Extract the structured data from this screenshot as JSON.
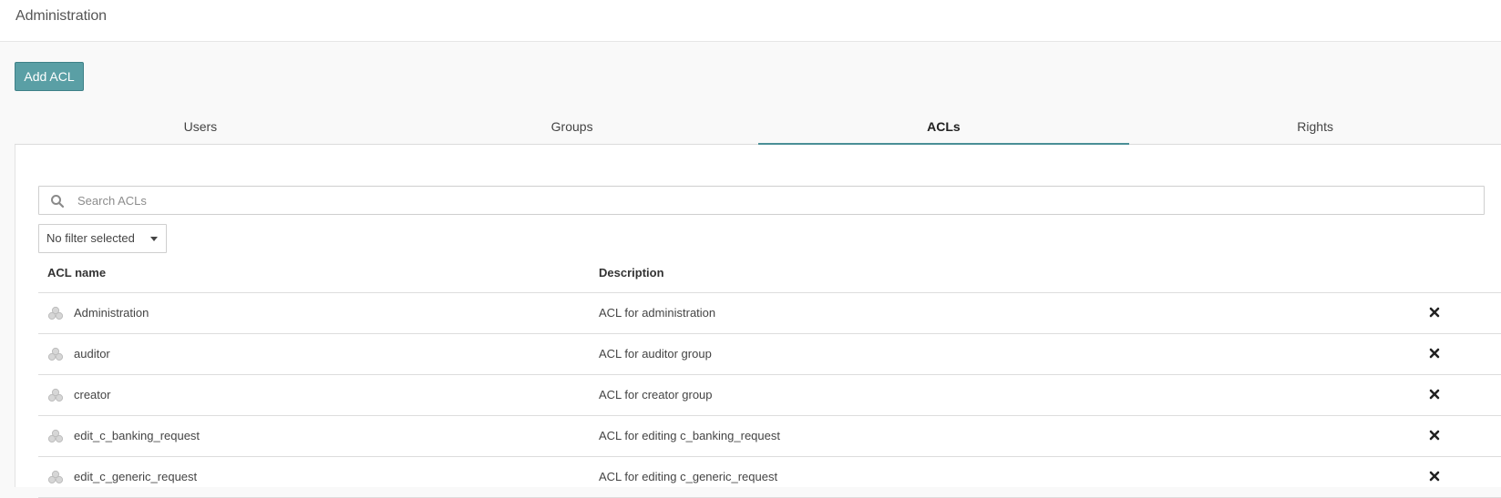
{
  "header": {
    "title": "Administration"
  },
  "toolbar": {
    "add_label": "Add ACL"
  },
  "tabs": [
    {
      "label": "Users",
      "active": false
    },
    {
      "label": "Groups",
      "active": false
    },
    {
      "label": "ACLs",
      "active": true
    },
    {
      "label": "Rights",
      "active": false
    }
  ],
  "search": {
    "placeholder": "Search ACLs",
    "value": "",
    "icon": "search-icon"
  },
  "filter": {
    "selected": "No filter selected"
  },
  "table": {
    "columns": {
      "name": "ACL name",
      "description": "Description"
    },
    "rows": [
      {
        "name": "Administration",
        "description": "ACL for administration"
      },
      {
        "name": "auditor",
        "description": "ACL for auditor group"
      },
      {
        "name": "creator",
        "description": "ACL for creator group"
      },
      {
        "name": "edit_c_banking_request",
        "description": "ACL for editing c_banking_request"
      },
      {
        "name": "edit_c_generic_request",
        "description": "ACL for editing c_generic_request"
      }
    ],
    "row_icon": "acl-cluster-icon",
    "delete_icon": "delete-x-icon"
  },
  "colors": {
    "accent": "#5a9fa5",
    "active_tab_underline": "#4a8f96"
  }
}
